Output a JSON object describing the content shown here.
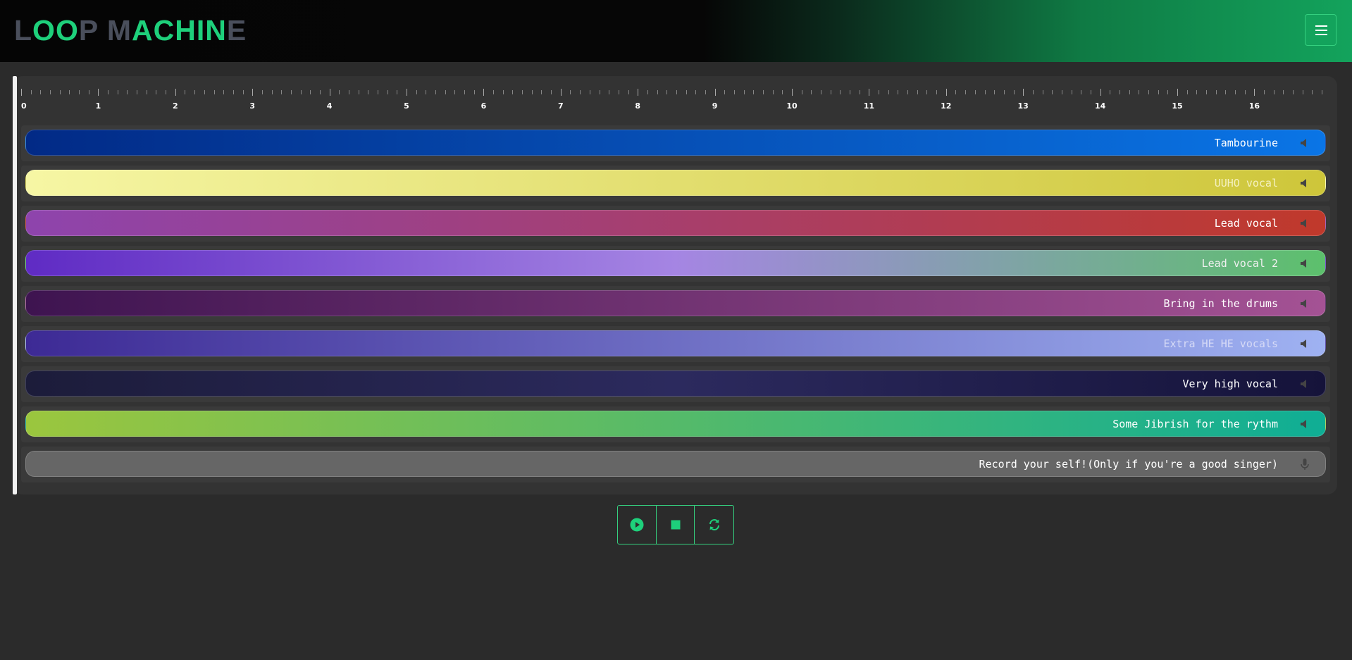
{
  "header": {
    "logo_segments": [
      {
        "text": "L",
        "color": "#4a4f5c"
      },
      {
        "text": "OO",
        "color": "#1ed07b"
      },
      {
        "text": "P ",
        "color": "#4a4f5c"
      },
      {
        "text": "M",
        "color": "#4a4f5c"
      },
      {
        "text": "ACHIN",
        "color": "#1ed07b"
      },
      {
        "text": "E",
        "color": "#4a4f5c"
      }
    ],
    "menu_icon": "hamburger-menu-icon"
  },
  "timeline": {
    "ticks": [
      "0",
      "1",
      "2",
      "3",
      "4",
      "5",
      "6",
      "7",
      "8",
      "9",
      "10",
      "11",
      "12",
      "13",
      "14",
      "15",
      "16"
    ]
  },
  "tracks": [
    {
      "label": "Tambourine",
      "text_color": "#ffffff",
      "icon": "speaker-icon",
      "gradient": [
        "#022a86",
        "#0a75e6"
      ]
    },
    {
      "label": "UUHO vocal",
      "text_color": "#f4f0c0",
      "icon": "speaker-icon",
      "gradient": [
        "#f6f6a4",
        "#cec63a"
      ]
    },
    {
      "label": "Lead vocal",
      "text_color": "#ffffff",
      "icon": "speaker-icon",
      "gradient": [
        "#8e44ad",
        "#c0392b"
      ]
    },
    {
      "label": "Lead vocal 2",
      "text_color": "#f0f0f0",
      "icon": "speaker-icon",
      "gradient": [
        "#5f2bc4",
        "#a585e3",
        "#5cc06c"
      ]
    },
    {
      "label": "Bring in the drums",
      "text_color": "#ffffff",
      "icon": "speaker-icon",
      "gradient": [
        "#3e1450",
        "#a45294"
      ]
    },
    {
      "label": "Extra HE HE vocals",
      "text_color": "#d6daf6",
      "icon": "speaker-icon",
      "gradient": [
        "#3d2a95",
        "#9fb2f2"
      ]
    },
    {
      "label": "Very high vocal",
      "text_color": "#ffffff",
      "icon": "speaker-icon",
      "gradient": [
        "#1c1c3a",
        "#2c2a5e",
        "#15133a"
      ]
    },
    {
      "label": "Some Jibrish for the rythm",
      "text_color": "#ffffff",
      "icon": "speaker-icon",
      "gradient": [
        "#9bc63e",
        "#0fae95"
      ]
    },
    {
      "label": "Record your self!(Only if you're a good singer)",
      "text_color": "#ffffff",
      "icon": "microphone-icon",
      "gradient": [
        "#666666",
        "#666666"
      ]
    }
  ],
  "controls": [
    {
      "name": "play-button",
      "icon": "play-icon"
    },
    {
      "name": "stop-button",
      "icon": "stop-icon"
    },
    {
      "name": "loop-button",
      "icon": "loop-icon"
    }
  ],
  "colors": {
    "accent": "#1ed07b",
    "background": "#2b2b2b"
  }
}
